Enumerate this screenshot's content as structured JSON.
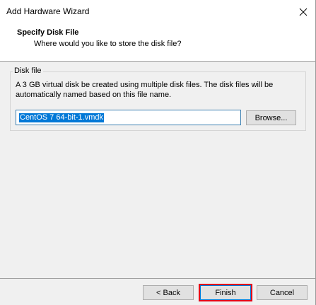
{
  "window": {
    "title": "Add Hardware Wizard",
    "close_glyph": "✕"
  },
  "header": {
    "title": "Specify Disk File",
    "subtitle": "Where would you like to store the disk file?"
  },
  "disk_file": {
    "group_label": "Disk file",
    "description": "A 3 GB virtual disk be created using multiple disk files. The disk files will be automatically named based on this file name.",
    "file_name": "CentOS 7 64-bit-1.vmdk",
    "browse_label": "Browse..."
  },
  "footer": {
    "back_label": "< Back",
    "finish_label": "Finish",
    "cancel_label": "Cancel"
  },
  "colors": {
    "highlight": "#e0001a",
    "selection": "#0078d7"
  }
}
